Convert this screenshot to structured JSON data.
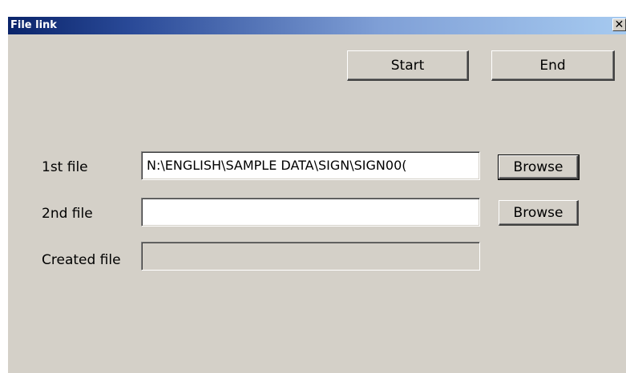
{
  "window": {
    "title": "File link",
    "close_glyph": "✕"
  },
  "toolbar": {
    "start_label": "Start",
    "end_label": "End"
  },
  "form": {
    "file1": {
      "label": "1st file",
      "value": "N:\\ENGLISH\\SAMPLE DATA\\SIGN\\SIGN00(",
      "browse_label": "Browse"
    },
    "file2": {
      "label": "2nd file",
      "value": "",
      "browse_label": "Browse"
    },
    "created": {
      "label": "Created file",
      "value": ""
    }
  }
}
